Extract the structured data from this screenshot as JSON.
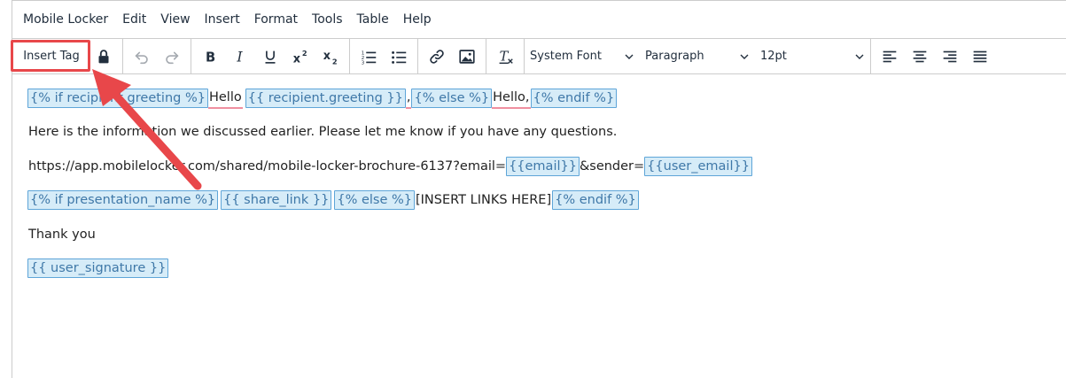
{
  "menubar": {
    "items": [
      "Mobile Locker",
      "Edit",
      "View",
      "Insert",
      "Format",
      "Tools",
      "Table",
      "Help"
    ]
  },
  "toolbar": {
    "insert_tag_label": "Insert Tag",
    "font_family": "System Font",
    "block_format": "Paragraph",
    "font_size": "12pt",
    "icons": [
      "lock-icon",
      "undo-icon",
      "redo-icon",
      "bold-icon",
      "italic-icon",
      "underline-icon",
      "superscript-icon",
      "subscript-icon",
      "numbered-list-icon",
      "bullet-list-icon",
      "link-icon",
      "image-icon",
      "clear-formatting-icon",
      "align-left-icon",
      "align-center-icon",
      "align-right-icon",
      "justify-icon"
    ]
  },
  "content": {
    "line1": {
      "tag1": "{% if recipient.greeting %}",
      "text1": "Hello",
      "tag2": "{{ recipient.greeting }}",
      "text2": ",",
      "tag3": "{% else %}",
      "text3": "Hello,",
      "tag4": "{% endif %}"
    },
    "line2": "Here is the information we discussed earlier. Please let me know if you have any questions.",
    "line3": {
      "text1": "https://app.mobilelocker.com/shared/mobile-locker-brochure-6137?email=",
      "tag1": "{{email}}",
      "text2": "&sender=",
      "tag2": "{{user_email}}"
    },
    "line4": {
      "tag1": "{% if presentation_name %}",
      "tag2": "{{ share_link }}",
      "tag3": "{% else %}",
      "text1": "[INSERT LINKS HERE]",
      "tag4": "{% endif %}"
    },
    "line5": "Thank you",
    "line6": {
      "tag1": "{{ user_signature }}"
    }
  },
  "colors": {
    "tag_bg": "#d6ecf8",
    "tag_border": "#5ea5d8",
    "annotation_red": "#e8474a"
  }
}
